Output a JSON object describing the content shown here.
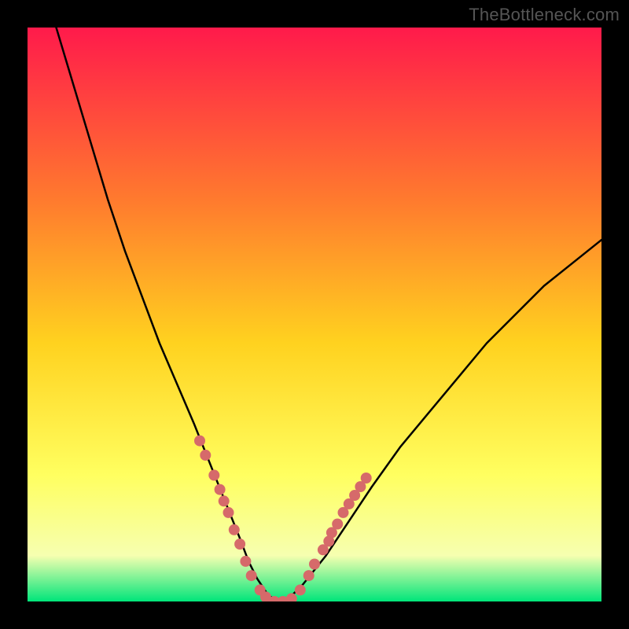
{
  "watermark": "TheBottleneck.com",
  "colors": {
    "frame": "#000000",
    "gradient_top": "#ff1a4b",
    "gradient_mid1": "#ff7a2e",
    "gradient_mid2": "#ffd21f",
    "gradient_mid3": "#ffff60",
    "gradient_mid4": "#f6ffb0",
    "gradient_bottom": "#00e57a",
    "curve": "#000000",
    "dots": "#d66a6a"
  },
  "chart_data": {
    "type": "line",
    "title": "",
    "xlabel": "",
    "ylabel": "",
    "xlim": [
      0,
      100
    ],
    "ylim": [
      0,
      100
    ],
    "grid": false,
    "legend": false,
    "series": [
      {
        "name": "bottleneck-curve",
        "x": [
          5,
          8,
          11,
          14,
          17,
          20,
          23,
          26,
          29,
          31,
          33,
          35,
          37,
          38.5,
          40,
          42,
          44,
          46,
          48,
          52,
          56,
          60,
          65,
          70,
          75,
          80,
          85,
          90,
          95,
          100
        ],
        "y": [
          100,
          90,
          80,
          70,
          61,
          53,
          45,
          38,
          31,
          26,
          21,
          16,
          11,
          7,
          4,
          1,
          0,
          1,
          3,
          8,
          14,
          20,
          27,
          33,
          39,
          45,
          50,
          55,
          59,
          63
        ]
      }
    ],
    "highlight_dots": {
      "name": "highlighted-range",
      "x": [
        30,
        31,
        32.5,
        33.5,
        34.2,
        35,
        36,
        37,
        38,
        39,
        40.5,
        41.5,
        43,
        44.5,
        46,
        47.5,
        49,
        50,
        51.5,
        52.5,
        53,
        54,
        55,
        56,
        57,
        58,
        59
      ],
      "y": [
        28,
        25.5,
        22,
        19.5,
        17.5,
        15.5,
        12.5,
        10,
        7,
        4.5,
        2,
        0.8,
        0,
        0,
        0.5,
        2,
        4.5,
        6.5,
        9,
        10.5,
        12,
        13.5,
        15.5,
        17,
        18.5,
        20,
        21.5
      ]
    },
    "annotations": []
  }
}
